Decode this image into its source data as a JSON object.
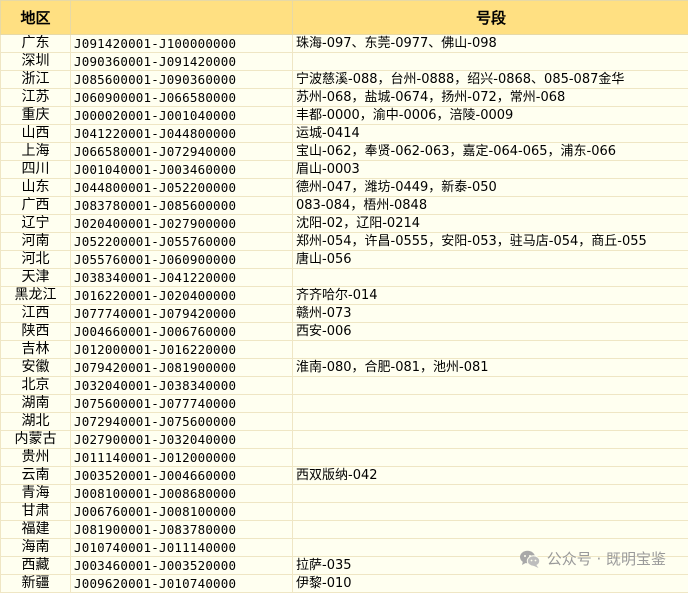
{
  "table": {
    "headers": [
      "地区",
      "",
      "号段"
    ],
    "rows": [
      {
        "region": "广东",
        "code": "J091420001-J100000000",
        "segment": "珠海-097、东莞-0977、佛山-098"
      },
      {
        "region": "深圳",
        "code": "J090360001-J091420000",
        "segment": ""
      },
      {
        "region": "浙江",
        "code": "J085600001-J090360000",
        "segment": "宁波慈溪-088，台州-0888，绍兴-0868、085-087金华"
      },
      {
        "region": "江苏",
        "code": "J060900001-J066580000",
        "segment": "苏州-068，盐城-0674，扬州-072，常州-068"
      },
      {
        "region": "重庆",
        "code": "J000020001-J001040000",
        "segment": "丰都-0000，渝中-0006，涪陵-0009"
      },
      {
        "region": "山西",
        "code": "J041220001-J044800000",
        "segment": "运城-0414"
      },
      {
        "region": "上海",
        "code": "J066580001-J072940000",
        "segment": "宝山-062，奉贤-062-063，嘉定-064-065，浦东-066"
      },
      {
        "region": "四川",
        "code": "J001040001-J003460000",
        "segment": "眉山-0003"
      },
      {
        "region": "山东",
        "code": "J044800001-J052200000",
        "segment": "德州-047，潍坊-0449，新泰-050"
      },
      {
        "region": "广西",
        "code": "J083780001-J085600000",
        "segment": "083-084，梧州-0848"
      },
      {
        "region": "辽宁",
        "code": "J020400001-J027900000",
        "segment": "沈阳-02，辽阳-0214"
      },
      {
        "region": "河南",
        "code": "J052200001-J055760000",
        "segment": "郑州-054，许昌-0555，安阳-053，驻马店-054，商丘-055"
      },
      {
        "region": "河北",
        "code": "J055760001-J060900000",
        "segment": "唐山-056"
      },
      {
        "region": "天津",
        "code": "J038340001-J041220000",
        "segment": ""
      },
      {
        "region": "黑龙江",
        "code": "J016220001-J020400000",
        "segment": "齐齐哈尔-014"
      },
      {
        "region": "江西",
        "code": "J077740001-J079420000",
        "segment": "赣州-073"
      },
      {
        "region": "陕西",
        "code": "J004660001-J006760000",
        "segment": "西安-006"
      },
      {
        "region": "吉林",
        "code": "J012000001-J016220000",
        "segment": ""
      },
      {
        "region": "安徽",
        "code": "J079420001-J081900000",
        "segment": "淮南-080，合肥-081，池州-081"
      },
      {
        "region": "北京",
        "code": "J032040001-J038340000",
        "segment": ""
      },
      {
        "region": "湖南",
        "code": "J075600001-J077740000",
        "segment": ""
      },
      {
        "region": "湖北",
        "code": "J072940001-J075600000",
        "segment": ""
      },
      {
        "region": "内蒙古",
        "code": "J027900001-J032040000",
        "segment": ""
      },
      {
        "region": "贵州",
        "code": "J011140001-J012000000",
        "segment": ""
      },
      {
        "region": "云南",
        "code": "J003520001-J004660000",
        "segment": "西双版纳-042"
      },
      {
        "region": "青海",
        "code": "J008100001-J008680000",
        "segment": ""
      },
      {
        "region": "甘肃",
        "code": "J006760001-J008100000",
        "segment": ""
      },
      {
        "region": "福建",
        "code": "J081900001-J083780000",
        "segment": ""
      },
      {
        "region": "海南",
        "code": "J010740001-J011140000",
        "segment": ""
      },
      {
        "region": "西藏",
        "code": "J003460001-J003520000",
        "segment": "拉萨-035"
      },
      {
        "region": "新疆",
        "code": "J009620001-J010740000",
        "segment": "伊黎-010"
      }
    ]
  },
  "watermark": {
    "icon": "wechat-icon",
    "text": "公众号 · 既明宝鉴"
  },
  "colors": {
    "header_bg": "#FFE082",
    "body_bg": "#FFFFF0",
    "grid": "#EFE6C4"
  }
}
